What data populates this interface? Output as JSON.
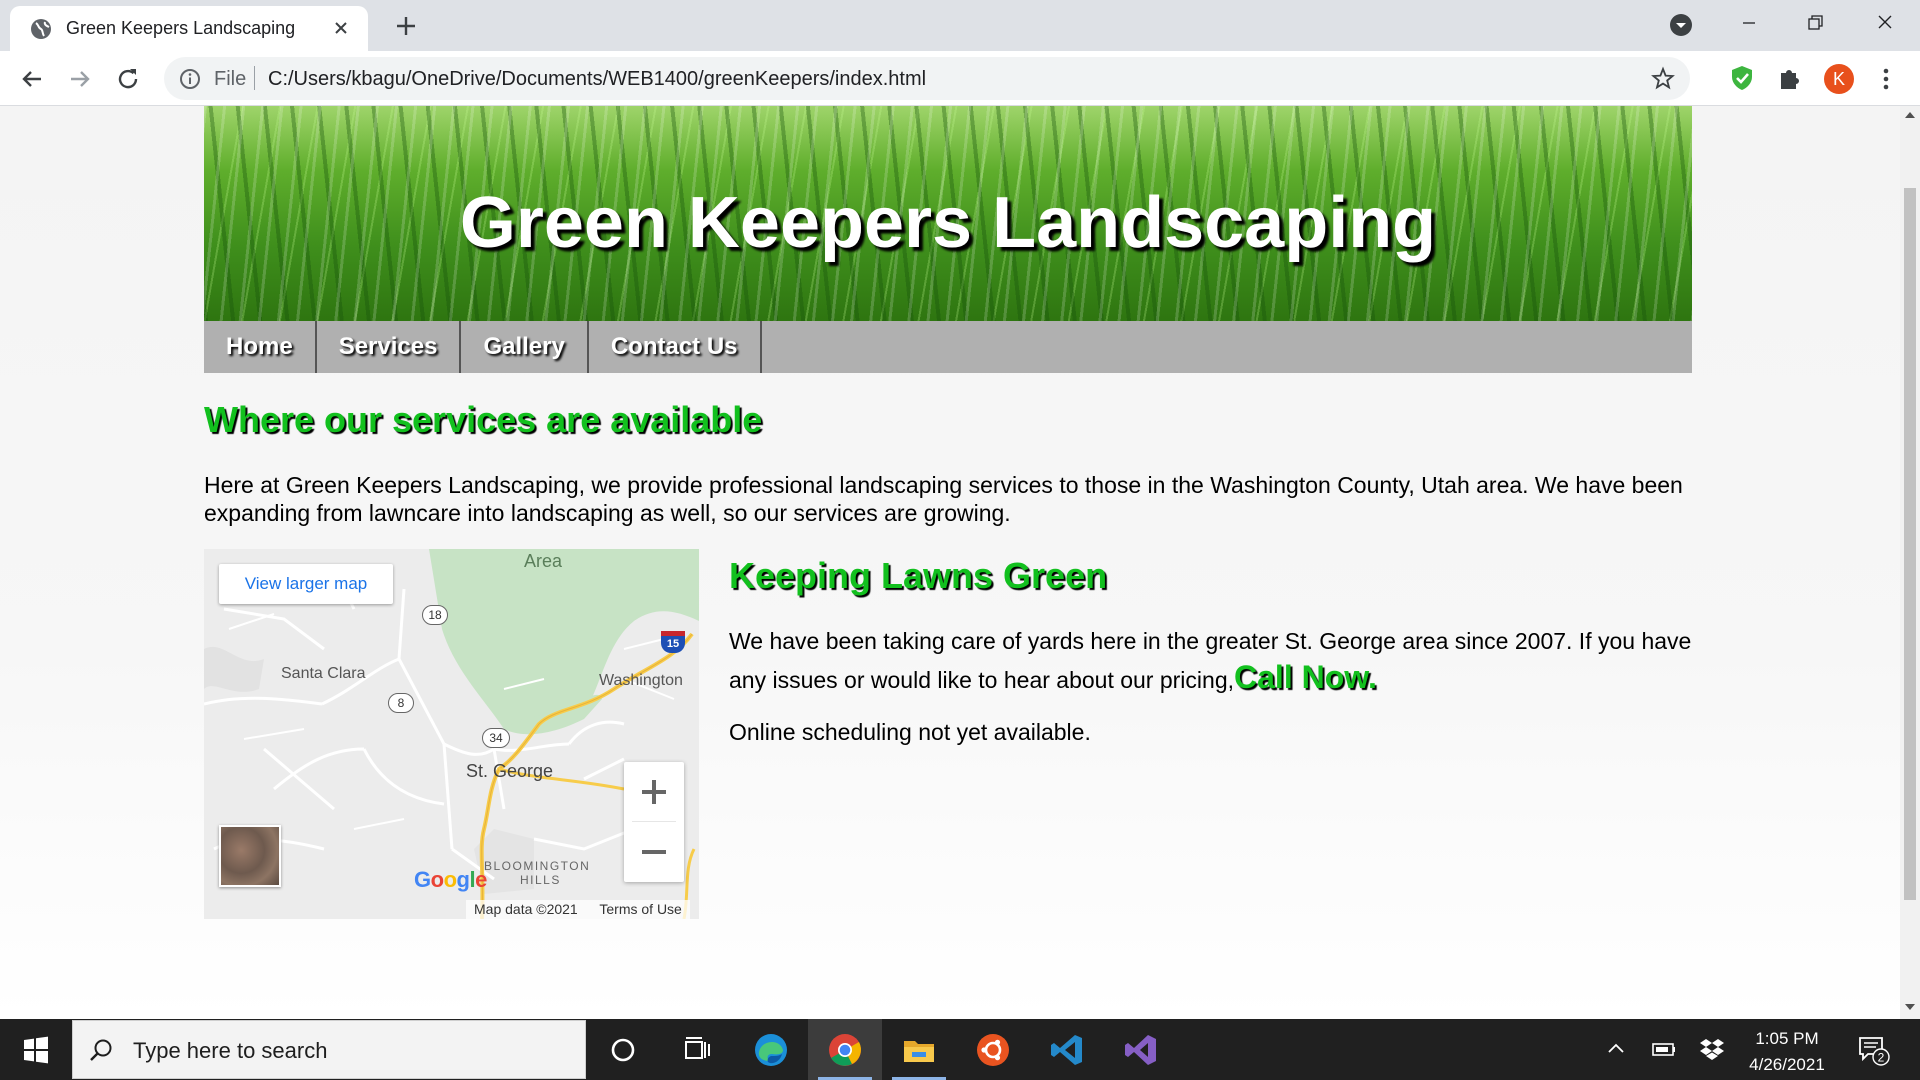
{
  "browser": {
    "tab_title": "Green Keepers Landscaping",
    "omnibox_scheme": "File",
    "url": "C:/Users/kbagu/OneDrive/Documents/WEB1400/greenKeepers/index.html",
    "profile_initial": "K",
    "profile_color": "#e8501c"
  },
  "site": {
    "banner_title": "Green Keepers Landscaping",
    "nav": [
      "Home",
      "Services",
      "Gallery",
      "Contact Us"
    ],
    "main_heading": "Where our services are available",
    "intro": "Here at Green Keepers Landscaping, we provide professional landscaping services to those in the Washington County, Utah area. We have been expanding from lawncare into landscaping as well, so our services are growing.",
    "side_heading": "Keeping Lawns Green",
    "side_text": "We have been taking care of yards here in the greater St. George area since 2007. If you have any issues or would like to hear about our pricing,",
    "call_now": "Call Now.",
    "side_text2": "Online scheduling not yet available.",
    "accent_green": "#12c01e"
  },
  "map": {
    "view_larger": "View larger map",
    "labels": {
      "area": "Area",
      "santa_clara": "Santa Clara",
      "washington": "Washington",
      "st_george": "St. George",
      "bloomington": "BLOOMINGTON",
      "hills": "HILLS"
    },
    "route_shields": {
      "r18": "18",
      "r8": "8",
      "r34": "34",
      "i15": "15"
    },
    "logo": "Google",
    "map_data": "Map data ©2021",
    "terms": "Terms of Use",
    "zoom_in": "+",
    "zoom_out": "−"
  },
  "taskbar": {
    "search_placeholder": "Type here to search",
    "time": "1:05 PM",
    "date": "4/26/2021",
    "notification_count": "2",
    "pinned_apps": [
      "cortana-icon",
      "task-view-icon",
      "edge-icon",
      "chrome-icon",
      "file-explorer-icon",
      "ubuntu-icon",
      "vscode-icon",
      "visual-studio-icon"
    ]
  }
}
